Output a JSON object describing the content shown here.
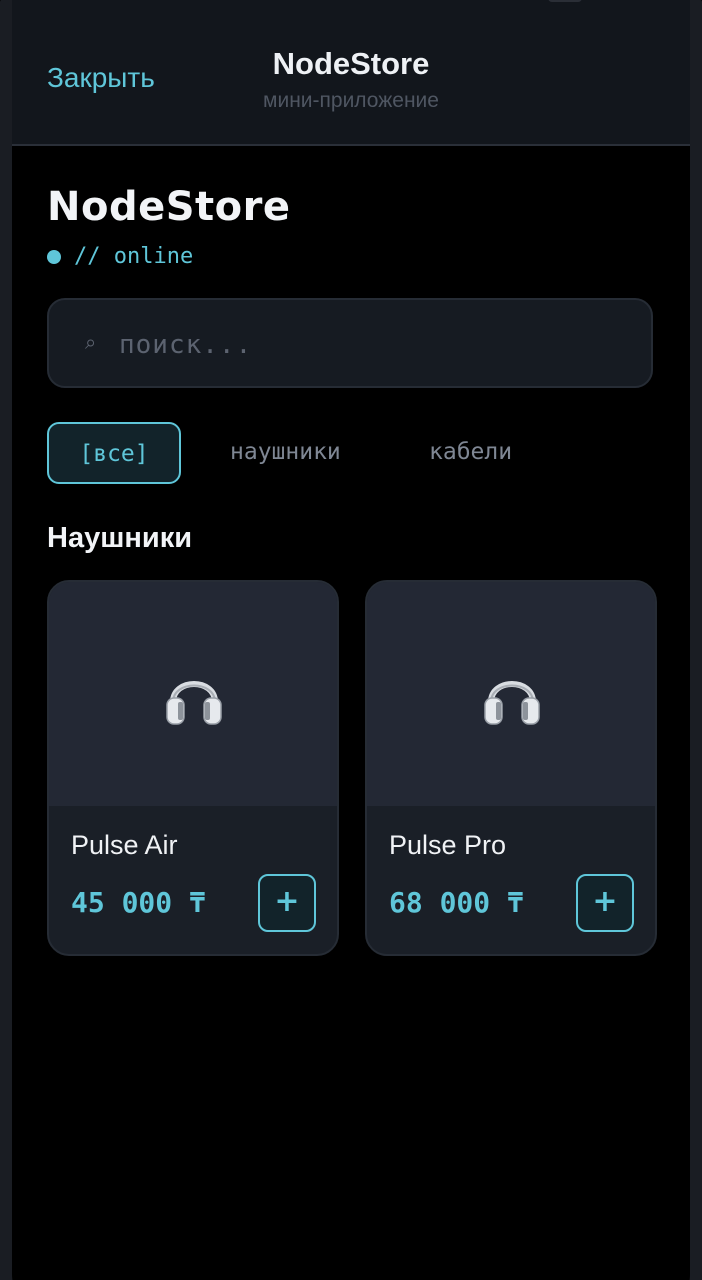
{
  "header": {
    "close_label": "Закрыть",
    "title": "NodeStore",
    "subtitle": "мини-приложение"
  },
  "store": {
    "title": "NodeStore",
    "status": "// online"
  },
  "search": {
    "icon": "search-icon",
    "placeholder": "поиск..."
  },
  "categories": [
    {
      "label": "[все]",
      "active": true
    },
    {
      "label": "наушники",
      "active": false
    },
    {
      "label": "кабели",
      "active": false
    }
  ],
  "section": {
    "title": "Наушники"
  },
  "products": [
    {
      "name": "Pulse Air",
      "price": "45 000 ₸",
      "icon": "headphones-icon",
      "add_label": "+"
    },
    {
      "name": "Pulse Pro",
      "price": "68 000 ₸",
      "icon": "headphones-icon",
      "add_label": "+"
    }
  ],
  "colors": {
    "accent": "#5fc6d9",
    "background": "#000000",
    "header_bg": "#12161c",
    "card_bg": "#1a1f27"
  }
}
